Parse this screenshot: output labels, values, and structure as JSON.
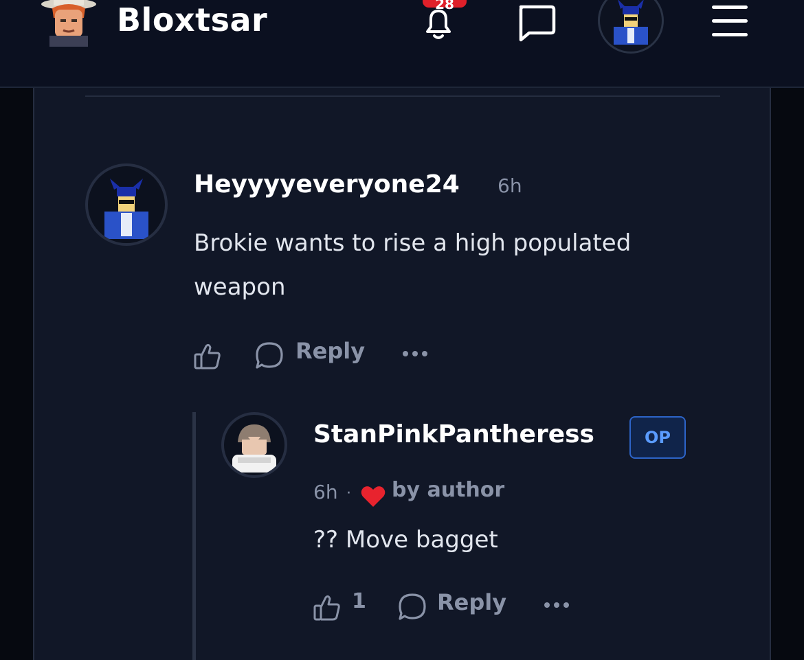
{
  "header": {
    "site_name": "Bloxtsar",
    "notification_count": "28",
    "icons": [
      "bell-icon",
      "chat-icon",
      "menu-icon"
    ]
  },
  "comments": [
    {
      "username": "Heyyyyeveryone24",
      "time": "6h",
      "text": "Brokie wants to rise a high populated weapon",
      "actions": {
        "reply_label": "Reply",
        "like_count": ""
      }
    },
    {
      "username": "StanPinkPantheress",
      "badge": "OP",
      "time": "6h",
      "separator": "·",
      "liked_by_author_label": "by author",
      "text": "?? Move bagget",
      "actions": {
        "reply_label": "Reply",
        "like_count": "1"
      }
    }
  ],
  "colors": {
    "background": "#0b0f1c",
    "card": "#111727",
    "muted": "#8a93a8",
    "badge_red": "#e0202a",
    "op_blue": "#5a9bff",
    "heart": "#e8232e"
  }
}
